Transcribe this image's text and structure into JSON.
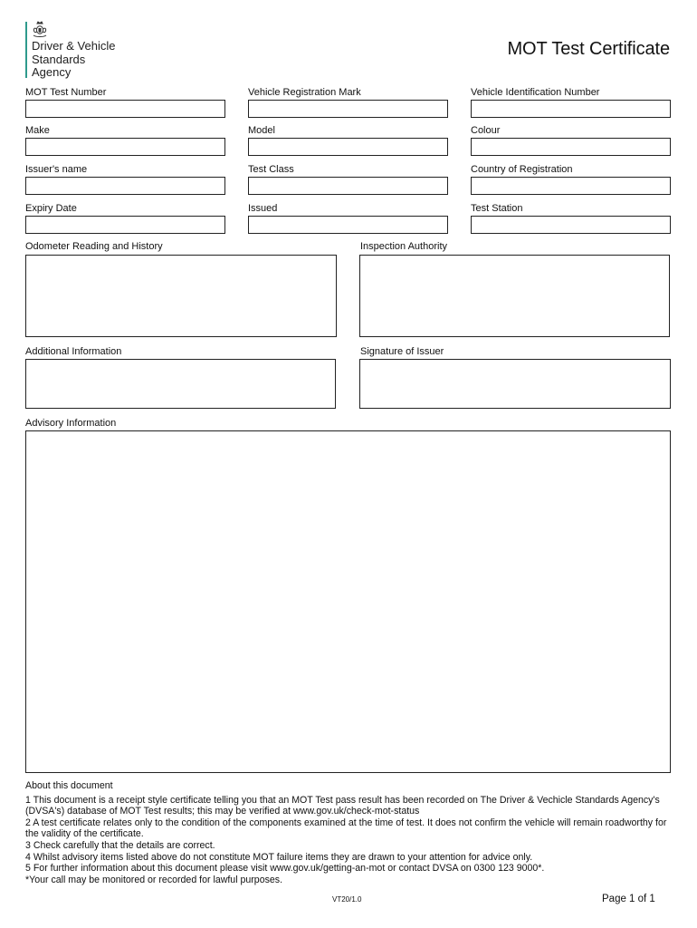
{
  "header": {
    "organisation_lines": [
      "Driver & Vehicle",
      "Standards",
      "Agency"
    ],
    "crest_icon": "royal-coat-of-arms",
    "brand_color": "#2e9a8c",
    "title": "MOT Test Certificate"
  },
  "fields": {
    "mot_test_number": {
      "label": "MOT Test Number",
      "value": ""
    },
    "vehicle_registration_mark": {
      "label": "Vehicle Registration Mark",
      "value": ""
    },
    "vehicle_identification_number": {
      "label": "Vehicle Identification Number",
      "value": ""
    },
    "make": {
      "label": "Make",
      "value": ""
    },
    "model": {
      "label": "Model",
      "value": ""
    },
    "colour": {
      "label": "Colour",
      "value": ""
    },
    "issuers_name": {
      "label": "Issuer's name",
      "value": ""
    },
    "test_class": {
      "label": "Test Class",
      "value": ""
    },
    "country_of_registration": {
      "label": "Country of Registration",
      "value": ""
    },
    "expiry_date": {
      "label": "Expiry Date",
      "value": ""
    },
    "issued": {
      "label": "Issued",
      "value": ""
    },
    "test_station": {
      "label": "Test Station",
      "value": ""
    },
    "odometer_reading_and_history": {
      "label": "Odometer Reading and History",
      "value": ""
    },
    "inspection_authority": {
      "label": "Inspection Authority",
      "value": ""
    },
    "additional_information": {
      "label": "Additional Information",
      "value": ""
    },
    "signature_of_issuer": {
      "label": "Signature of Issuer",
      "value": ""
    },
    "advisory_information": {
      "label": "Advisory Information",
      "value": ""
    }
  },
  "about": {
    "heading": "About this document",
    "lines": [
      "1  This document is a receipt style certificate telling you that an MOT Test pass result has been recorded on The Driver & Vechicle Standards Agency's (DVSA's) database of MOT Test results; this may be verified at www.gov.uk/check-mot-status",
      "2  A test certificate relates only to the condition of the components examined at the time of test. It does not confirm the vehicle will remain roadworthy for the validity of the certificate.",
      "3  Check carefully that the details are correct.",
      "4  Whilst advisory items listed above do not constitute MOT failure items they are drawn to your attention for advice only.",
      "5  For further information about this document please visit www.gov.uk/getting-an-mot or contact DVSA on 0300 123 9000*.",
      "*Your call may be monitored or recorded for lawful purposes."
    ]
  },
  "footer": {
    "form_code": "VT20/1.0",
    "page_label": "Page 1 of 1"
  }
}
